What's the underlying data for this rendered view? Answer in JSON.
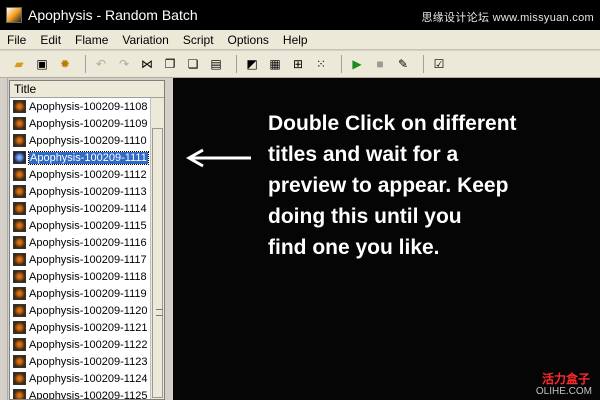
{
  "window": {
    "title": "Apophysis - Random Batch",
    "watermark": "思缘设计论坛 www.missyuan.com"
  },
  "menu": [
    {
      "label": "File"
    },
    {
      "label": "Edit"
    },
    {
      "label": "Flame"
    },
    {
      "label": "Variation"
    },
    {
      "label": "Script"
    },
    {
      "label": "Options"
    },
    {
      "label": "Help"
    }
  ],
  "toolbar_icons": [
    "open-icon",
    "save-icon",
    "gear-icon",
    "undo-icon",
    "redo-icon",
    "flip-icon",
    "copy-icon",
    "paste-icon",
    "clipboard-icon",
    "gradient-icon",
    "palette-icon",
    "tile-icon",
    "grid-icon",
    "play-icon",
    "stop-icon",
    "edit-script-icon",
    "checkbox-icon"
  ],
  "list": {
    "header": "Title",
    "items": [
      "Apophysis-100209-1108",
      "Apophysis-100209-1109",
      "Apophysis-100209-1110",
      "Apophysis-100209-1111",
      "Apophysis-100209-1112",
      "Apophysis-100209-1113",
      "Apophysis-100209-1114",
      "Apophysis-100209-1115",
      "Apophysis-100209-1116",
      "Apophysis-100209-1117",
      "Apophysis-100209-1118",
      "Apophysis-100209-1119",
      "Apophysis-100209-1120",
      "Apophysis-100209-1121",
      "Apophysis-100209-1122",
      "Apophysis-100209-1123",
      "Apophysis-100209-1124",
      "Apophysis-100209-1125"
    ],
    "selected_index": 3
  },
  "preview": {
    "caption_lines": [
      "Double Click on different",
      "titles and wait for a",
      "preview to appear. Keep",
      "doing this until you",
      "find one you like."
    ],
    "watermark_cn": "活力盒子",
    "watermark_en": "OLIHE.COM"
  },
  "colors": {
    "selection": "#316ac5",
    "preview_bg": "#050505",
    "watermark_red": "#ff2a2a"
  }
}
